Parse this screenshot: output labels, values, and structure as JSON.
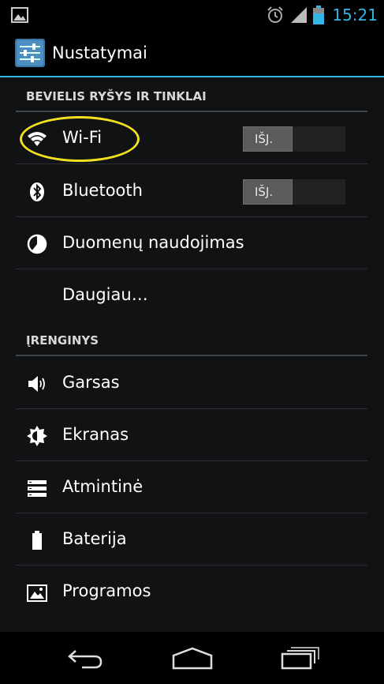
{
  "status_bar": {
    "time": "15:21",
    "icons": [
      "gallery-notification-icon",
      "alarm-icon",
      "signal-icon",
      "battery-icon"
    ],
    "accent_color": "#33b5e5"
  },
  "action_bar": {
    "title": "Nustatymai",
    "icon": "settings-icon"
  },
  "sections": [
    {
      "header": "BEVIELIS RYŠYS IR TINKLAI",
      "items": [
        {
          "label": "Wi-Fi",
          "icon": "wifi-icon",
          "toggle": "IŠJ."
        },
        {
          "label": "Bluetooth",
          "icon": "bluetooth-icon",
          "toggle": "IŠJ."
        },
        {
          "label": "Duomenų naudojimas",
          "icon": "data-usage-icon"
        },
        {
          "label": "Daugiau…"
        }
      ]
    },
    {
      "header": "ĮRENGINYS",
      "items": [
        {
          "label": "Garsas",
          "icon": "speaker-icon"
        },
        {
          "label": "Ekranas",
          "icon": "brightness-icon"
        },
        {
          "label": "Atmintinė",
          "icon": "storage-icon"
        },
        {
          "label": "Baterija",
          "icon": "battery-icon"
        },
        {
          "label": "Programos",
          "icon": "apps-icon"
        }
      ]
    }
  ],
  "nav_bar": {
    "icons": [
      "back-icon",
      "home-icon",
      "recent-apps-icon"
    ]
  },
  "highlight_color": "#f0e020"
}
